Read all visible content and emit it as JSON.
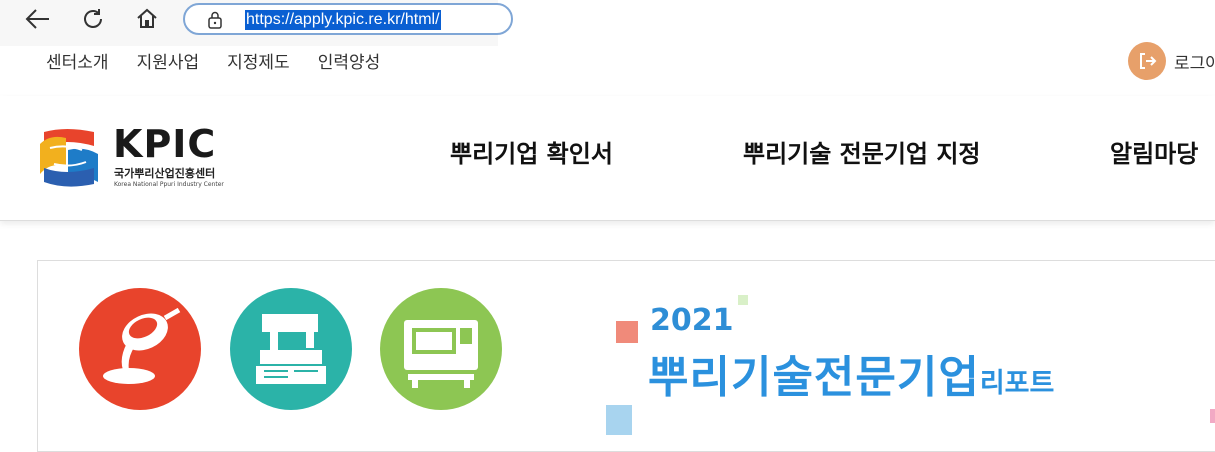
{
  "browser": {
    "url": "https://apply.kpic.re.kr/html/"
  },
  "util_menu": {
    "items": [
      "센터소개",
      "지원사업",
      "지정제도",
      "인력양성"
    ],
    "login_label": "로그아"
  },
  "logo": {
    "name": "KPIC",
    "korean": "국가뿌리산업진흥센터",
    "english": "Korea National Ppuri Industry Center"
  },
  "main_nav": {
    "items": [
      "뿌리기업 확인서",
      "뿌리기술 전문기업 지정",
      "알림마당"
    ]
  },
  "banner": {
    "year": "2021",
    "title_main": "뿌리기술전문기업",
    "title_sub": "리포트"
  },
  "colors": {
    "accent_blue": "#2b91de",
    "icon_red": "#e8442c",
    "icon_teal": "#2bb3a8",
    "icon_green": "#8dc653",
    "login_orange": "#e7a06a"
  },
  "icons": [
    "back-arrow-icon",
    "refresh-icon",
    "home-icon",
    "lock-icon",
    "logout-icon",
    "pouring-ladle-icon",
    "machine-icon",
    "cnc-lathe-icon"
  ]
}
